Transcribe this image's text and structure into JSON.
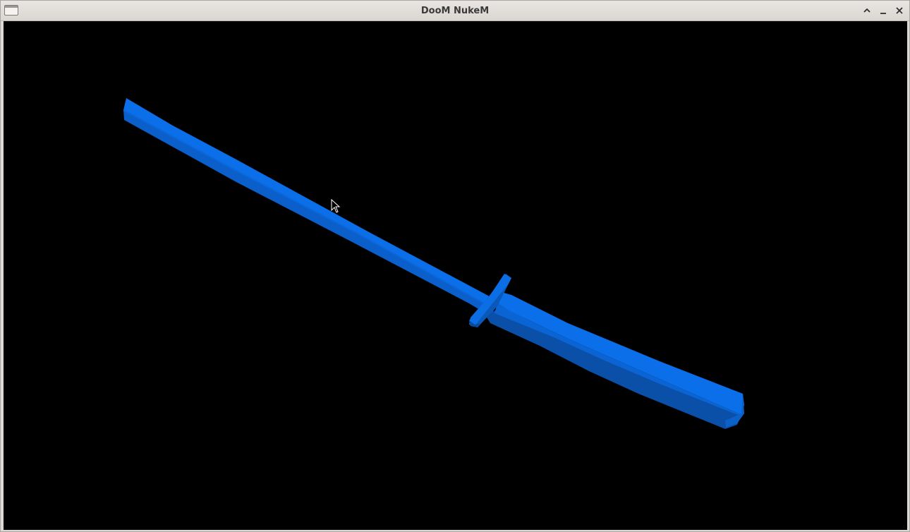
{
  "window": {
    "title": "DooM NukeM",
    "buttons": {
      "maximize_icon": "chevron-up-icon",
      "minimize_icon": "minimize-icon",
      "close_icon": "close-icon"
    }
  },
  "viewport": {
    "background": "#000000",
    "object": "sword-model",
    "object_color": "#0a6fe8"
  }
}
